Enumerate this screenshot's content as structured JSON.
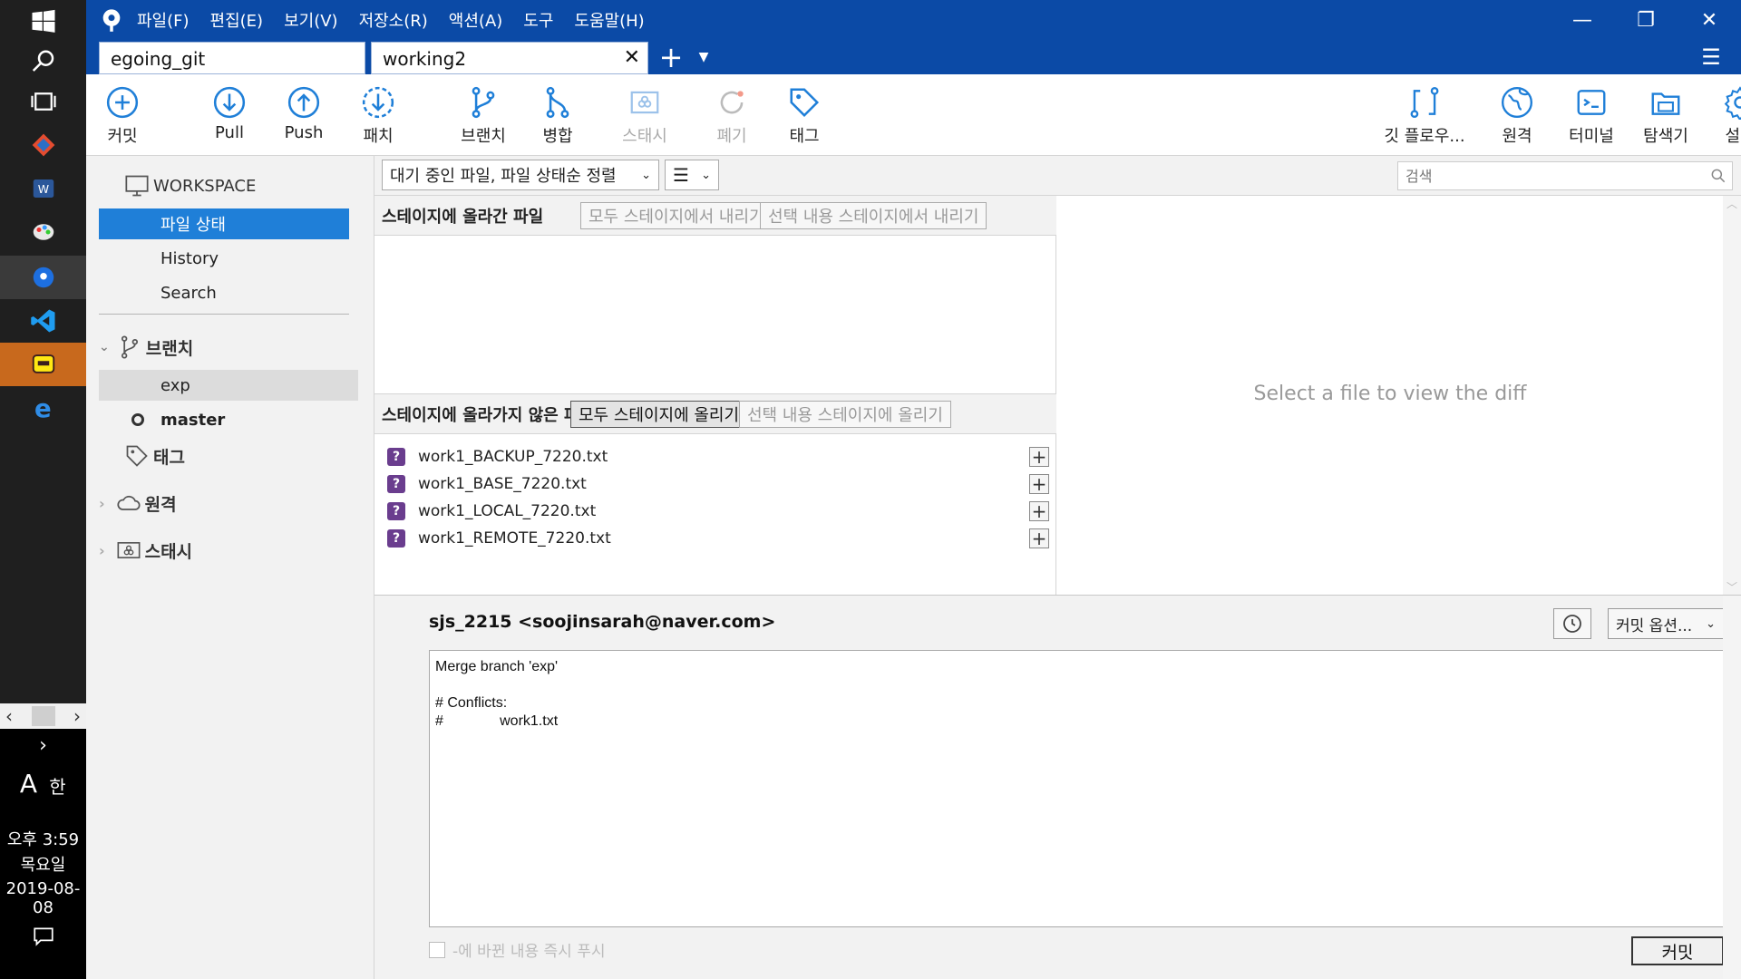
{
  "taskbar": {
    "time": "오후 3:59",
    "weekday": "목요일",
    "date": "2019-08-08",
    "ime_lang": "A",
    "ime_mode": "한"
  },
  "menubar": {
    "items": [
      "파일(F)",
      "편집(E)",
      "보기(V)",
      "저장소(R)",
      "액션(A)",
      "도구",
      "도움말(H)"
    ]
  },
  "tabs": [
    {
      "label": "egoing_git"
    },
    {
      "label": "working2"
    }
  ],
  "toolbar": {
    "commit": "커밋",
    "pull": "Pull",
    "push": "Push",
    "fetch": "패치",
    "branch": "브랜치",
    "merge": "병합",
    "stash": "스태시",
    "discard": "폐기",
    "tag": "태그",
    "gitflow": "깃 플로우...",
    "remote": "원격",
    "terminal": "터미널",
    "explorer": "탐색기",
    "settings": "설정"
  },
  "sidebar": {
    "workspace": "WORKSPACE",
    "file_status": "파일 상태",
    "history": "History",
    "search": "Search",
    "branches": "브랜치",
    "branch_items": [
      "exp",
      "master"
    ],
    "tags": "태그",
    "remotes": "원격",
    "stashes": "스태시"
  },
  "filterbar": {
    "sort_label": "대기 중인 파일, 파일 상태순 정렬",
    "search_placeholder": "검색"
  },
  "staged": {
    "title": "스테이지에 올라간 파일",
    "unstage_all": "모두 스테이지에서 내리기",
    "unstage_selected": "선택 내용 스테이지에서 내리기"
  },
  "unstaged": {
    "title": "스테이지에 올라가지 않은 파일",
    "stage_all": "모두 스테이지에 올리기",
    "stage_selected": "선택 내용 스테이지에 올리기",
    "files": [
      {
        "name": "work1_BACKUP_7220.txt",
        "status": "?"
      },
      {
        "name": "work1_BASE_7220.txt",
        "status": "?"
      },
      {
        "name": "work1_LOCAL_7220.txt",
        "status": "?"
      },
      {
        "name": "work1_REMOTE_7220.txt",
        "status": "?"
      }
    ]
  },
  "diff": {
    "message": "Select a file to view the diff"
  },
  "commit": {
    "author": "sjs_2215 <soojinsarah@naver.com>",
    "options_label": "커밋 옵션...",
    "message": "Merge branch 'exp'\n\n# Conflicts:\n#\t\twork1.txt",
    "push_label": "-에 바뀐 내용 즉시 푸시",
    "commit_button": "커밋"
  },
  "colors": {
    "titlebar": "#0b4aa6",
    "selection": "#1f7fd8",
    "untracked_badge": "#6a3d8e"
  }
}
